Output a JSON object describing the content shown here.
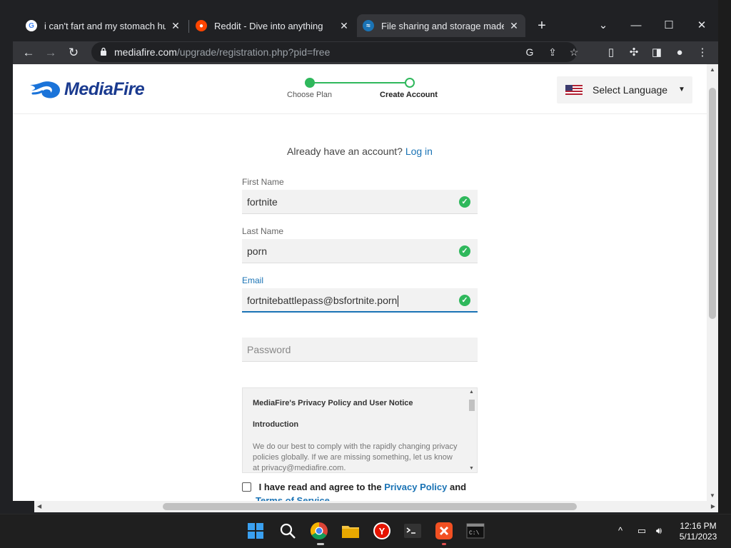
{
  "browser": {
    "tabs": [
      {
        "title": "i can't fart and my stomach hurts",
        "favicon": "google-icon"
      },
      {
        "title": "Reddit - Dive into anything",
        "favicon": "reddit-icon"
      },
      {
        "title": "File sharing and storage made simple",
        "favicon": "mediafire-icon",
        "active": true
      }
    ],
    "new_tab": "+",
    "url_domain": "mediafire.com",
    "url_path": "/upgrade/registration.php?pid=free"
  },
  "site": {
    "logo": "MediaFire",
    "steps": [
      "Choose Plan",
      "Create Account"
    ],
    "language": "Select Language"
  },
  "form": {
    "already_text": "Already have an account?",
    "login_link": "Log in",
    "first_name_label": "First Name",
    "first_name_value": "fortnite",
    "last_name_label": "Last Name",
    "last_name_value": "porn",
    "email_label": "Email",
    "email_value": "fortnitebattlepass@bsfortnite.porn",
    "password_placeholder": "Password",
    "policy_title": "MediaFire's Privacy Policy and User Notice",
    "policy_intro": "Introduction",
    "policy_body": "We do our best to comply with the rapidly changing privacy policies globally. If we are missing something, let us know at privacy@mediafire.com.",
    "agree_prefix": "I have read and agree to the",
    "agree_link": "Privacy Policy",
    "agree_and": "and",
    "agree_terms": "Terms of Service"
  },
  "taskbar": {
    "time": "12:16 PM",
    "date": "5/11/2023"
  },
  "colors": {
    "accent": "#1a73b5",
    "success": "#2fb85c",
    "logo": "#1a3a8f"
  }
}
